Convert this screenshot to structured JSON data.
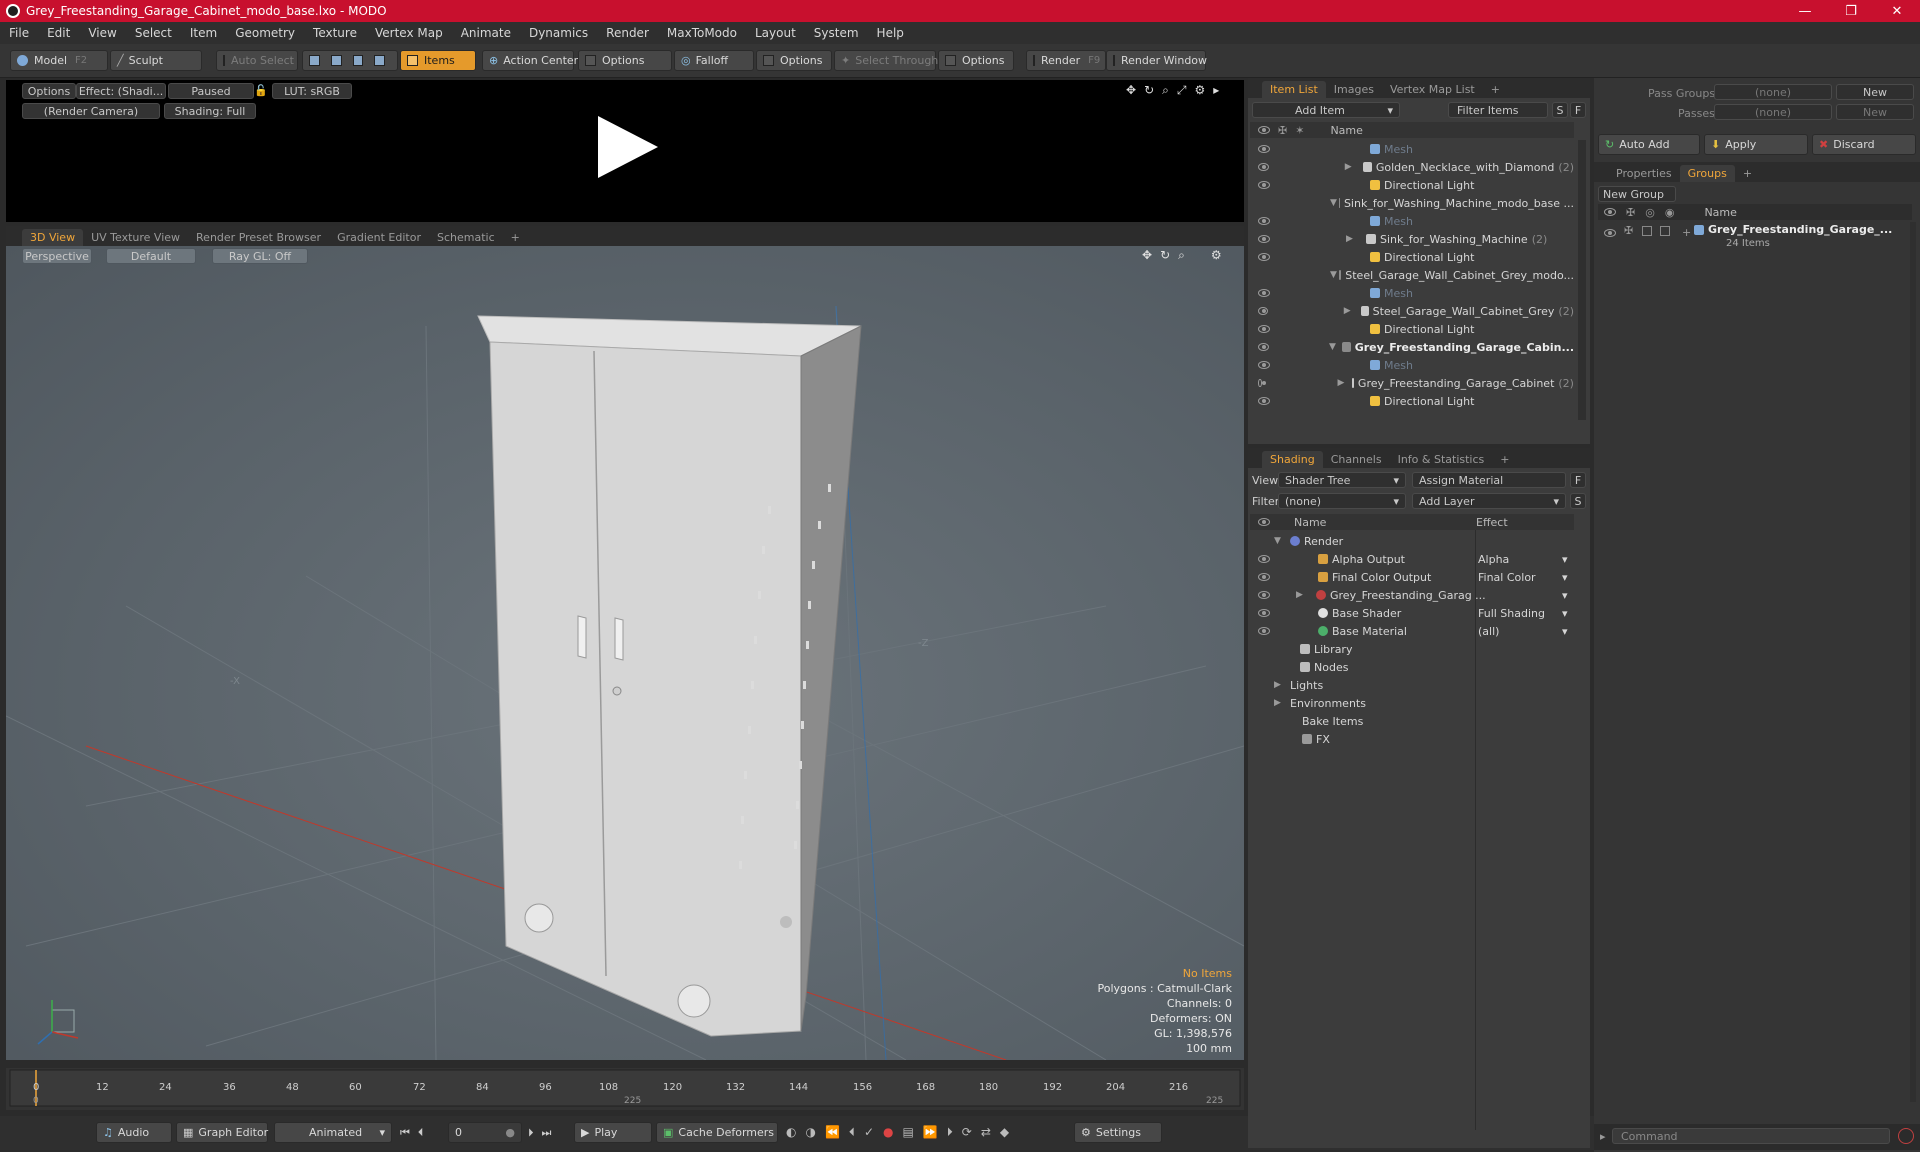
{
  "window": {
    "title": "Grey_Freestanding_Garage_Cabinet_modo_base.lxo - MODO"
  },
  "menu": [
    "File",
    "Edit",
    "View",
    "Select",
    "Item",
    "Geometry",
    "Texture",
    "Vertex Map",
    "Animate",
    "Dynamics",
    "Render",
    "MaxToModo",
    "Layout",
    "System",
    "Help"
  ],
  "toolbar": {
    "model": "Model",
    "model_key": "F2",
    "sculpt": "Sculpt",
    "auto_select": "Auto Select",
    "items": "Items",
    "action_center": "Action Center",
    "options1": "Options",
    "falloff": "Falloff",
    "options2": "Options",
    "select_through": "Select Through",
    "options3": "Options",
    "render": "Render",
    "render_key": "F9",
    "render_window": "Render Window"
  },
  "render_view": {
    "options": "Options",
    "effect": "Effect: (Shadi...",
    "paused": "Paused",
    "lut": "LUT: sRGB",
    "camera": "(Render Camera)",
    "shading": "Shading: Full"
  },
  "viewport_tabs": [
    "3D View",
    "UV Texture View",
    "Render Preset Browser",
    "Gradient Editor",
    "Schematic"
  ],
  "viewport": {
    "perspective": "Perspective",
    "default": "Default",
    "raygl": "Ray GL: Off",
    "axis_x": "-X",
    "axis_z": "-Z",
    "info": [
      "No Items",
      "Polygons : Catmull-Clark",
      "Channels: 0",
      "Deformers: ON",
      "GL: 1,398,576",
      "100 mm"
    ]
  },
  "timeline": {
    "ticks": [
      "0",
      "12",
      "24",
      "36",
      "48",
      "60",
      "72",
      "84",
      "96",
      "108",
      "120",
      "132",
      "144",
      "156",
      "168",
      "180",
      "192",
      "204",
      "216"
    ],
    "start": "0",
    "mid": "225",
    "end": "225"
  },
  "bottombar": {
    "audio": "Audio",
    "graph_editor": "Graph Editor",
    "animated": "Animated",
    "frame": "0",
    "play": "Play",
    "cache": "Cache Deformers",
    "settings": "Settings"
  },
  "item_list": {
    "tabs": [
      "Item List",
      "Images",
      "Vertex Map List"
    ],
    "add_item": "Add Item",
    "filter": "Filter Items",
    "s": "S",
    "f": "F",
    "name_col": "Name",
    "rows": [
      {
        "label": "Mesh",
        "count": ""
      },
      {
        "label": "Golden_Necklace_with_Diamond",
        "count": "(2)"
      },
      {
        "label": "Directional Light",
        "count": ""
      },
      {
        "label": "Sink_for_Washing_Machine_modo_base ...",
        "count": ""
      },
      {
        "label": "Mesh",
        "count": ""
      },
      {
        "label": "Sink_for_Washing_Machine",
        "count": "(2)"
      },
      {
        "label": "Directional Light",
        "count": ""
      },
      {
        "label": "Steel_Garage_Wall_Cabinet_Grey_modo...",
        "count": ""
      },
      {
        "label": "Mesh",
        "count": ""
      },
      {
        "label": "Steel_Garage_Wall_Cabinet_Grey",
        "count": "(2)"
      },
      {
        "label": "Directional Light",
        "count": ""
      },
      {
        "label": "Grey_Freestanding_Garage_Cabin...",
        "count": ""
      },
      {
        "label": "Mesh",
        "count": ""
      },
      {
        "label": "Grey_Freestanding_Garage_Cabinet",
        "count": "(2)"
      },
      {
        "label": "Directional Light",
        "count": ""
      }
    ]
  },
  "shading": {
    "tabs": [
      "Shading",
      "Channels",
      "Info & Statistics"
    ],
    "view_label": "View",
    "view_value": "Shader Tree",
    "assign": "Assign Material",
    "f": "F",
    "filter_label": "Filter",
    "filter_value": "(none)",
    "add_layer": "Add Layer",
    "s": "S",
    "col_name": "Name",
    "col_effect": "Effect",
    "rows": [
      {
        "name": "Render",
        "effect": ""
      },
      {
        "name": "Alpha Output",
        "effect": "Alpha"
      },
      {
        "name": "Final Color Output",
        "effect": "Final Color"
      },
      {
        "name": "Grey_Freestanding_Garag ...",
        "effect": ""
      },
      {
        "name": "Base Shader",
        "effect": "Full Shading"
      },
      {
        "name": "Base Material",
        "effect": "(all)"
      },
      {
        "name": "Library",
        "effect": ""
      },
      {
        "name": "Nodes",
        "effect": ""
      },
      {
        "name": "Lights",
        "effect": ""
      },
      {
        "name": "Environments",
        "effect": ""
      },
      {
        "name": "Bake Items",
        "effect": ""
      },
      {
        "name": "FX",
        "effect": ""
      }
    ]
  },
  "right_panel": {
    "pass_groups": "Pass Groups",
    "passes": "Passes",
    "none1": "(none)",
    "none2": "(none)",
    "new1": "New",
    "new2": "New",
    "auto_add": "Auto Add",
    "apply": "Apply",
    "discard": "Discard",
    "tabs": [
      "Properties",
      "Groups"
    ],
    "new_group": "New Group",
    "name_col": "Name",
    "group_name": "Grey_Freestanding_Garage_...",
    "group_count": "24 Items",
    "command": "Command"
  },
  "colors": {
    "accent": "#f0a63a",
    "title_red": "#c8102e",
    "viewport_bg": "#5f6870"
  }
}
